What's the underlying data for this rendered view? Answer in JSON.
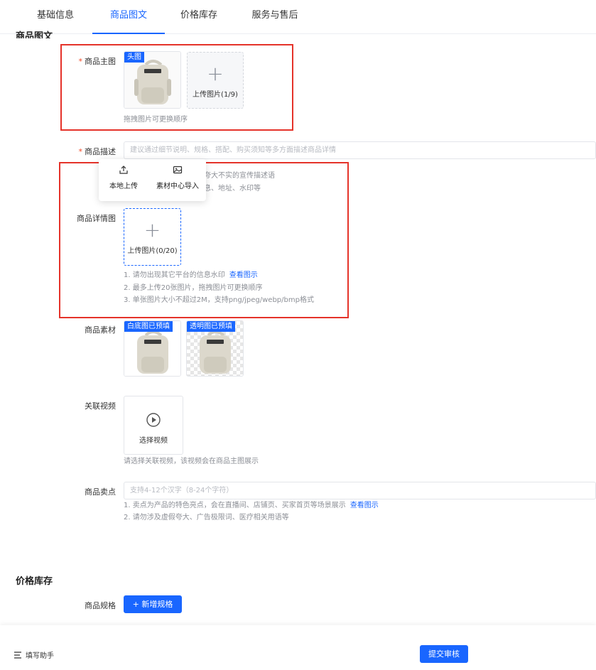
{
  "tabs": [
    {
      "label": "基础信息"
    },
    {
      "label": "商品图文"
    },
    {
      "label": "价格库存"
    },
    {
      "label": "服务与售后"
    }
  ],
  "section_title": "商品图文",
  "main_image": {
    "label": "商品主图",
    "cover_tag": "头图",
    "upload_label": "上传图片(1/9)",
    "hint": "拖拽图片可更换顺序"
  },
  "description": {
    "label": "商品描述",
    "placeholder": "建议通过细节说明、规格、搭配、购买须知等多方面描述商品详情",
    "hint1_visible": "夸大不实的宣传描述语",
    "hint2_visible": "息、地址、水印等"
  },
  "upload_popover": {
    "local": "本地上传",
    "library": "素材中心导入"
  },
  "detail_images": {
    "label": "商品详情图",
    "upload_label": "上传图片(0/20)",
    "hint1": "1. 请勿出现其它平台的信息水印",
    "hint1_link": "查看图示",
    "hint2": "2. 最多上传20张图片，拖拽图片可更换顺序",
    "hint3": "3. 单张图片大小不超过2M，支持png/jpeg/webp/bmp格式"
  },
  "material": {
    "label": "商品素材",
    "white_tag": "白底图已预填",
    "transparent_tag": "透明图已预填"
  },
  "video": {
    "label": "关联视频",
    "button": "选择视频",
    "hint": "请选择关联视频，该视频会在商品主图展示"
  },
  "selling_point": {
    "label": "商品卖点",
    "placeholder": "支持4-12个汉字（8-24个字符）",
    "hint1": "1. 卖点为产品的特色亮点，会在直播间、店铺页、买家首页等场景展示",
    "hint1_link": "查看图示",
    "hint2": "2. 请勿涉及虚假夸大、广告极限词、医疗相关用语等"
  },
  "price_section": {
    "title": "价格库存",
    "spec_label": "商品规格",
    "add_spec": "+ 新增规格"
  },
  "footer": {
    "assistant": "填写助手",
    "submit": "提交审核"
  },
  "colors": {
    "accent": "#1966ff",
    "required": "#f24724",
    "highlight_box": "#e5332a"
  }
}
